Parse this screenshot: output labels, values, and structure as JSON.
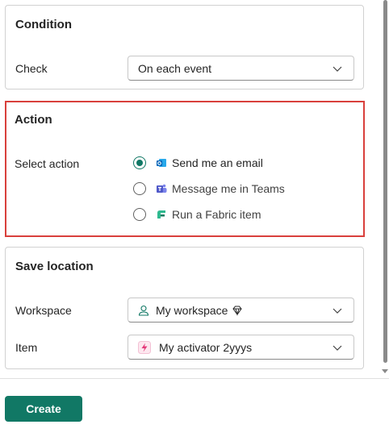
{
  "condition": {
    "title": "Condition",
    "check_label": "Check",
    "check_value": "On each event"
  },
  "action": {
    "title": "Action",
    "select_label": "Select action",
    "options": [
      {
        "label": "Send me an email",
        "icon": "outlook-icon",
        "selected": true
      },
      {
        "label": "Message me in Teams",
        "icon": "teams-icon",
        "selected": false
      },
      {
        "label": "Run a Fabric item",
        "icon": "fabric-icon",
        "selected": false
      }
    ]
  },
  "save_location": {
    "title": "Save location",
    "workspace_label": "Workspace",
    "workspace_value": "My workspace",
    "item_label": "Item",
    "item_value": "My activator 2yyys"
  },
  "footer": {
    "create_label": "Create"
  },
  "colors": {
    "accent": "#117865",
    "highlight_border": "#d9403c"
  }
}
